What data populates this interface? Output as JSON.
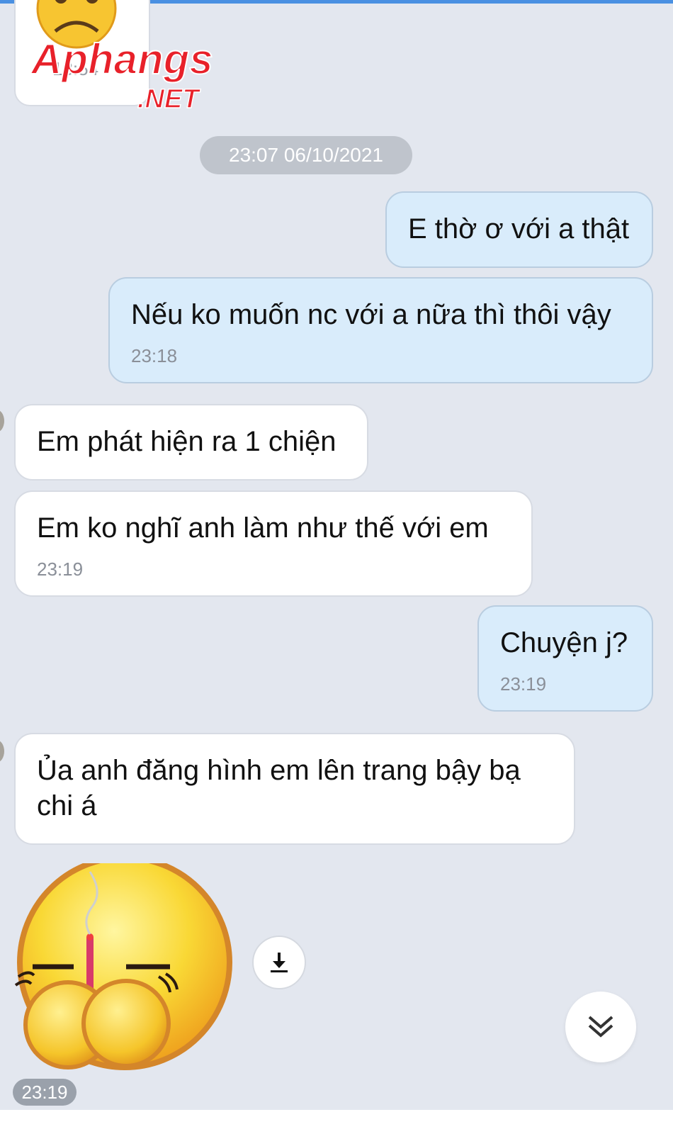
{
  "colors": {
    "background": "#e3e7ef",
    "incoming_bubble": "#ffffff",
    "outgoing_bubble": "#d9ecfb",
    "date_pill": "#bfc4cc",
    "time_text": "#8a8f98"
  },
  "top_sticker": {
    "icon": "sad-face-sticker",
    "time": "13:54"
  },
  "watermark": {
    "brand": "Aphangs",
    "suffix": ".NET"
  },
  "date_divider": "23:07 06/10/2021",
  "messages": [
    {
      "direction": "out",
      "text": "E thờ ơ với a thật",
      "time": ""
    },
    {
      "direction": "out",
      "text": "Nếu ko muốn nc với a nữa thì thôi vậy",
      "time": "23:18"
    },
    {
      "direction": "in",
      "text": "Em phát hiện ra 1 chiện",
      "time": ""
    },
    {
      "direction": "in",
      "text": "Em ko nghĩ anh làm như thế với em",
      "time": "23:19"
    },
    {
      "direction": "out",
      "text": "Chuyện j?",
      "time": "23:19"
    },
    {
      "direction": "in",
      "text": "Ủa anh đăng hình em lên trang bậy bạ chi á",
      "time": ""
    }
  ],
  "sticker_message": {
    "icon": "incense-emoji-sticker",
    "time": "23:19"
  },
  "controls": {
    "download_icon": "download-icon",
    "scroll_icon": "chevron-double-down-icon"
  }
}
